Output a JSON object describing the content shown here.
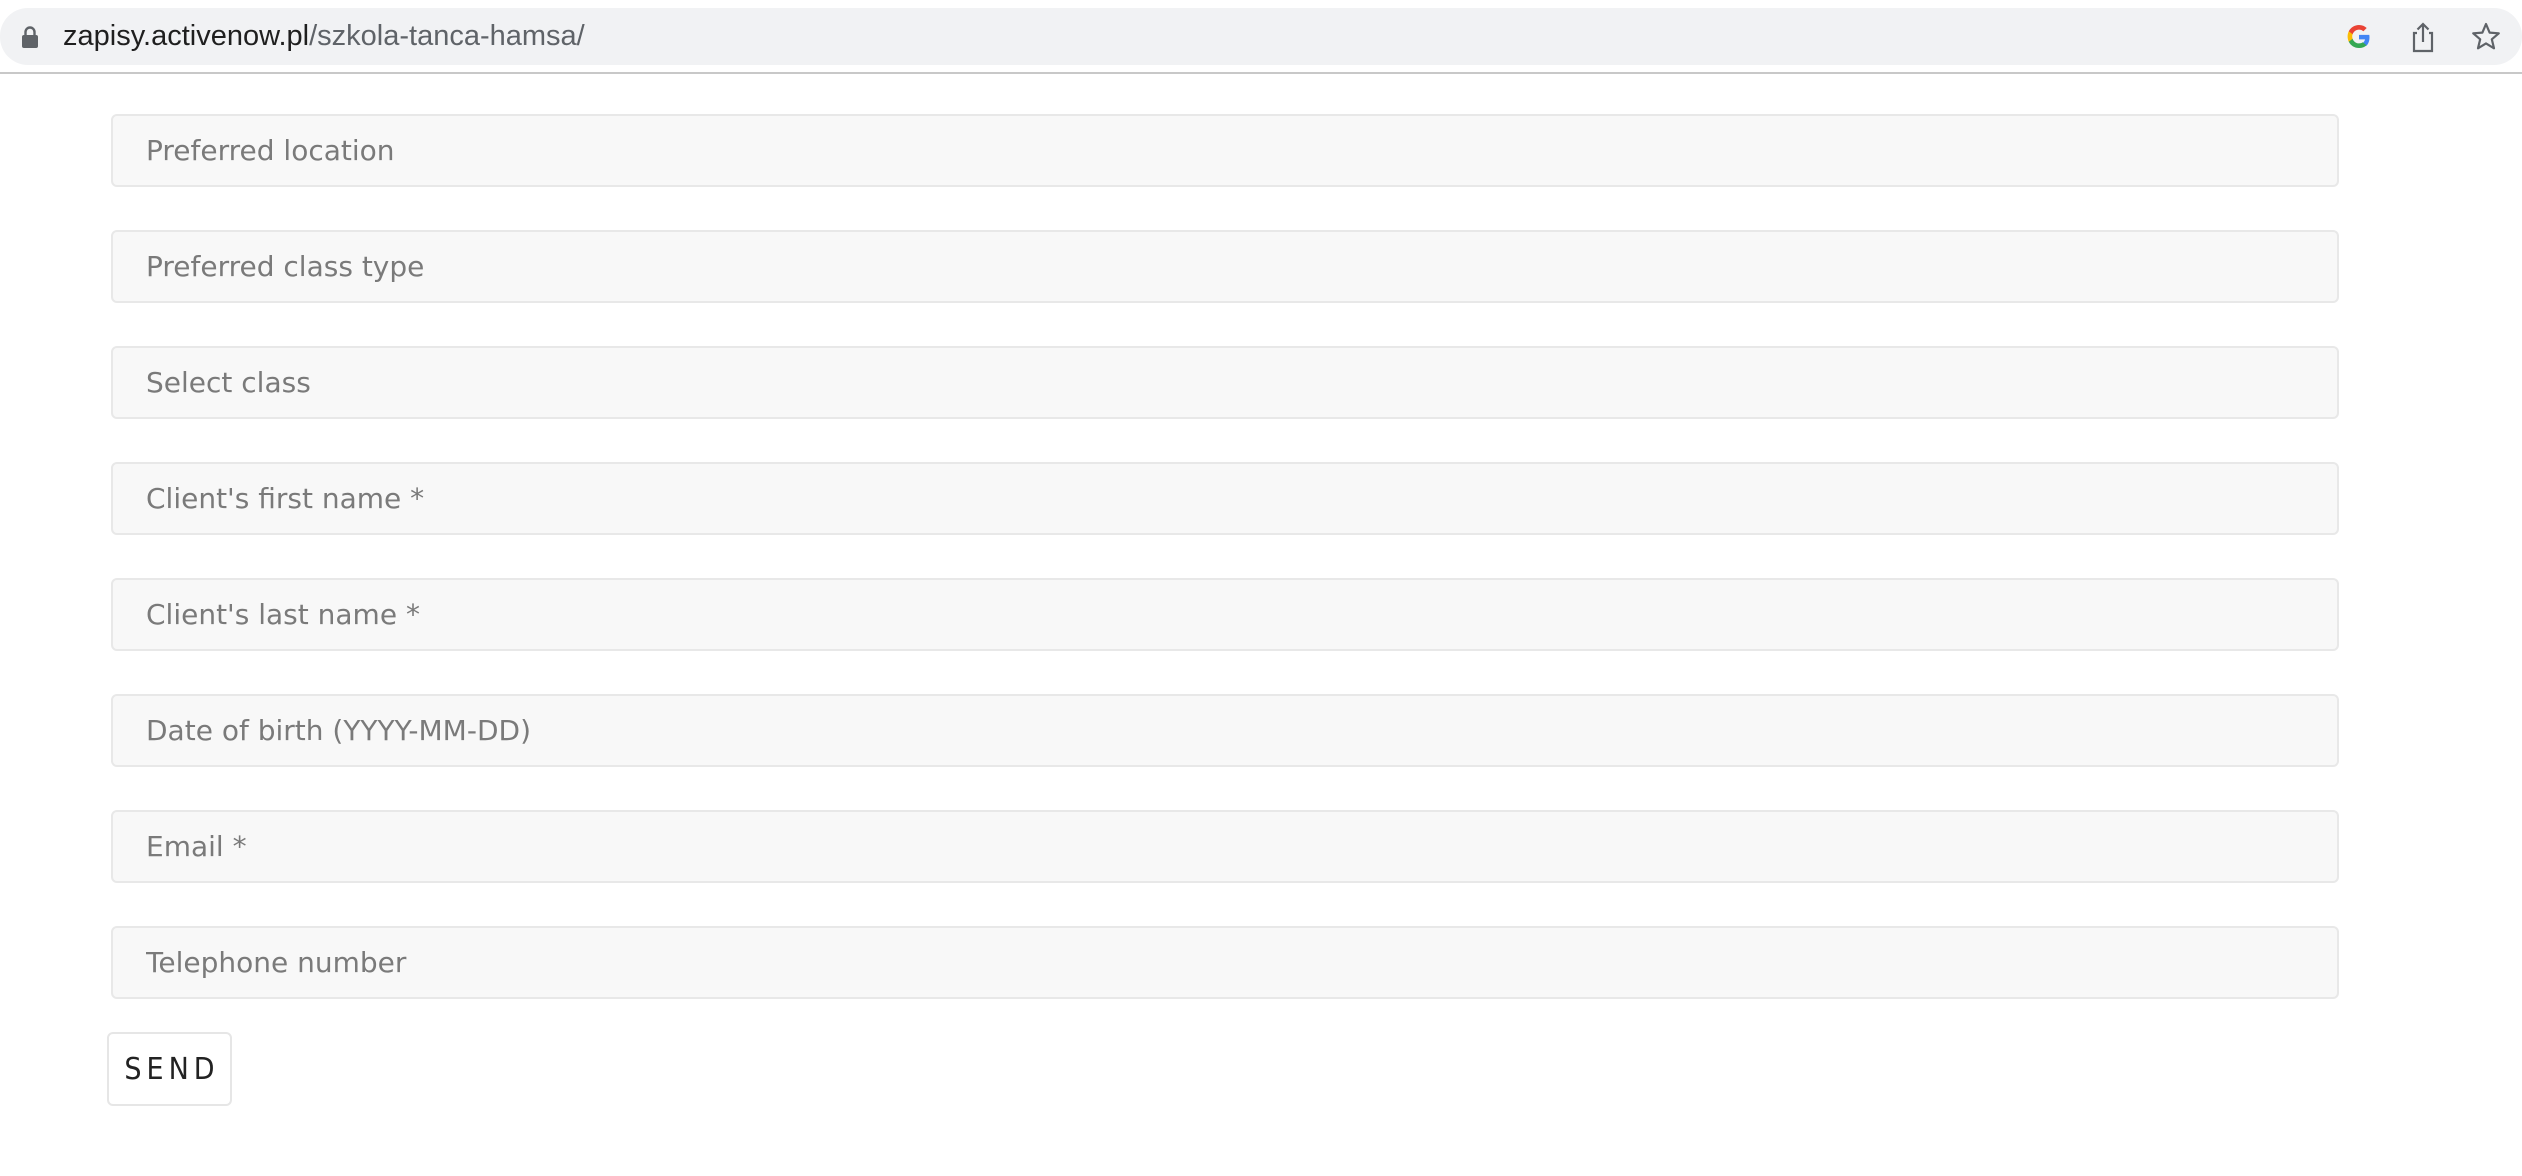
{
  "browser": {
    "url_host": "zapisy.activenow.pl",
    "url_path": "/szkola-tanca-hamsa/",
    "icons": [
      "lock-icon",
      "google-icon",
      "share-icon",
      "star-icon"
    ]
  },
  "form": {
    "fields": [
      {
        "placeholder": "Preferred location",
        "value": ""
      },
      {
        "placeholder": "Preferred class type",
        "value": ""
      },
      {
        "placeholder": "Select class",
        "value": ""
      },
      {
        "placeholder": "Client's first name *",
        "value": ""
      },
      {
        "placeholder": "Client's last name *",
        "value": ""
      },
      {
        "placeholder": "Date of birth (YYYY-MM-DD)",
        "value": ""
      },
      {
        "placeholder": "Email *",
        "value": ""
      },
      {
        "placeholder": "Telephone number",
        "value": ""
      }
    ],
    "send_label": "SEND"
  },
  "colors": {
    "field_background": "#f8f8f8",
    "field_border": "#e8e8e8",
    "placeholder_text": "#7a7a7a",
    "addressbar_background": "#f1f2f4"
  }
}
